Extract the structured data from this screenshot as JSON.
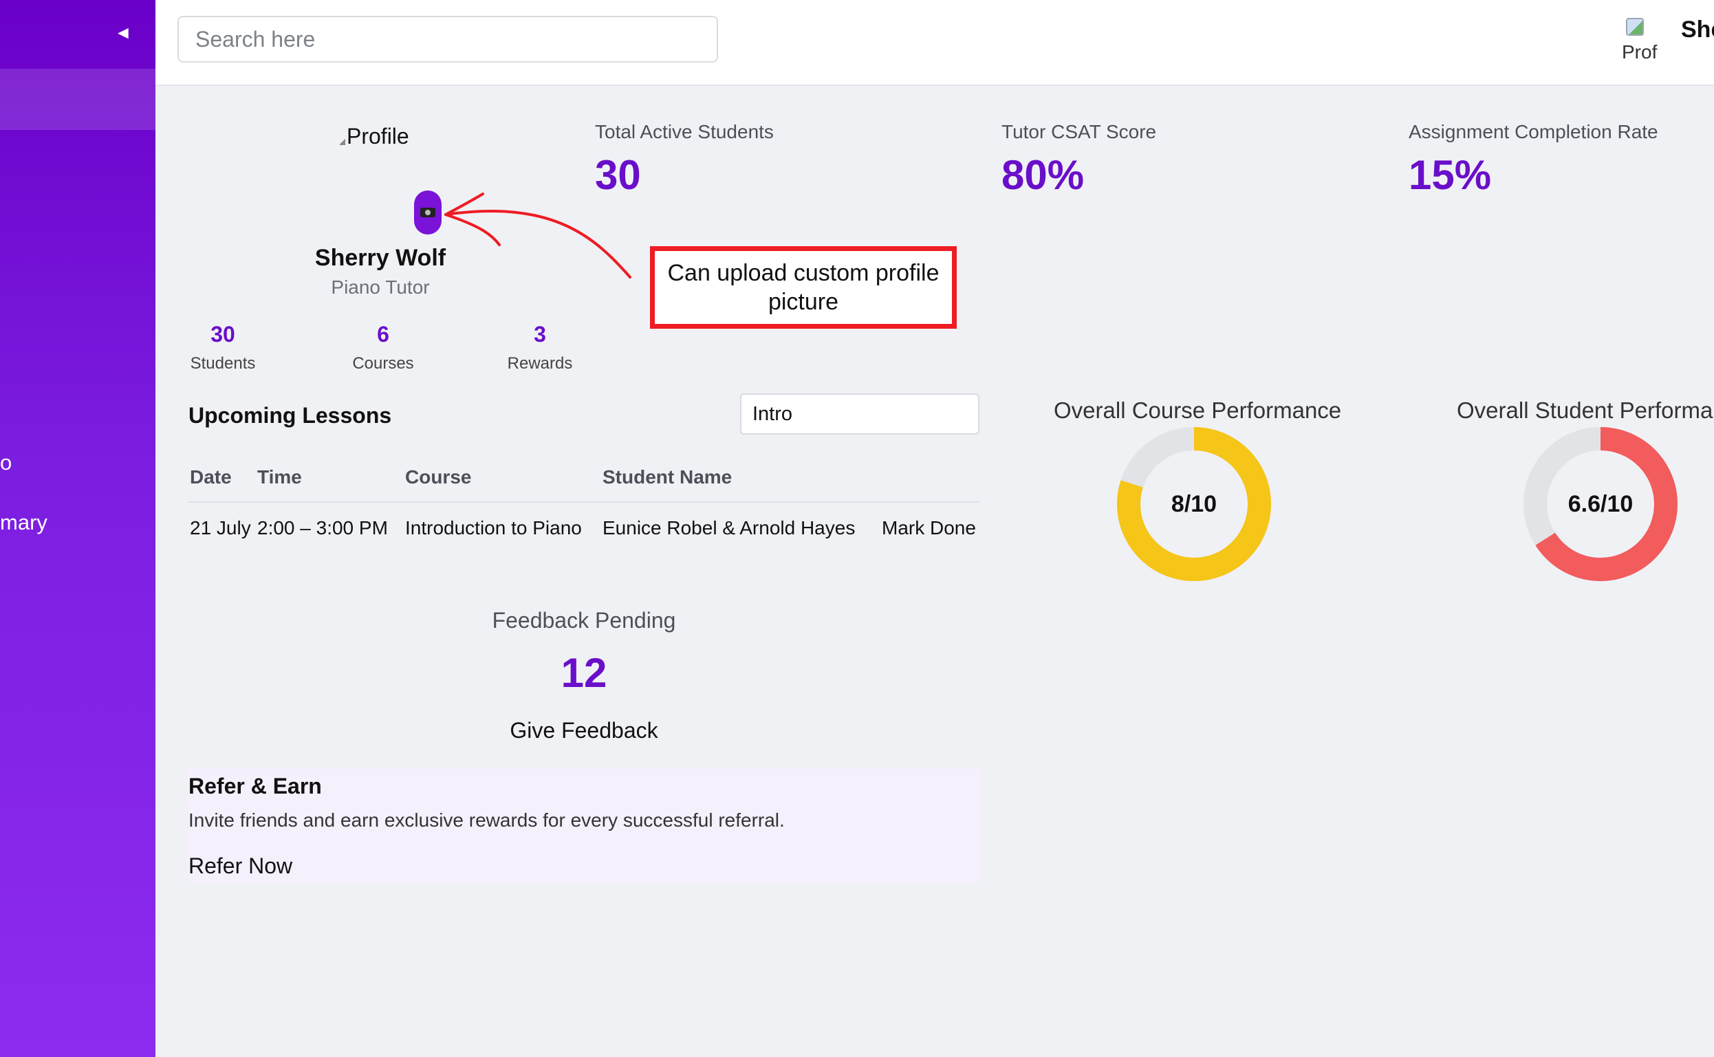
{
  "sidebar": {
    "toggle_icon": "◄",
    "items": [
      {
        "label": "o"
      },
      {
        "label": "mary"
      }
    ]
  },
  "header": {
    "search_placeholder": "Search here",
    "avatar_alt": "Prof",
    "user_name": "She"
  },
  "profile": {
    "image_alt": "Profile",
    "camera_icon": "camera-icon",
    "name": "Sherry Wolf",
    "role": "Piano Tutor",
    "stats": [
      {
        "value": "30",
        "label": "Students"
      },
      {
        "value": "6",
        "label": "Courses"
      },
      {
        "value": "3",
        "label": "Rewards"
      }
    ]
  },
  "kpis": [
    {
      "label": "Total Active Students",
      "value": "30"
    },
    {
      "label": "Tutor CSAT Score",
      "value": "80%"
    },
    {
      "label": "Assignment Completion Rate",
      "value": "15%"
    }
  ],
  "annotation": {
    "text": "Can upload custom profile picture",
    "color": "#ee1c23"
  },
  "lessons": {
    "title": "Upcoming Lessons",
    "filter_value": "Intro",
    "columns": [
      "Date",
      "Time",
      "Course",
      "Student Name"
    ],
    "rows": [
      {
        "date": "21 July",
        "time": "2:00 – 3:00 PM",
        "course": "Introduction to Piano",
        "students": "Eunice Robel & Arnold Hayes",
        "action": "Mark Done"
      }
    ]
  },
  "feedback": {
    "label": "Feedback Pending",
    "value": "12",
    "button": "Give Feedback"
  },
  "refer": {
    "title": "Refer & Earn",
    "description": "Invite friends and earn exclusive rewards for every successful referral.",
    "button": "Refer Now"
  },
  "performance": [
    {
      "title": "Overall Course Performance",
      "display": "8/10",
      "score": 8,
      "max": 10,
      "color": "#f5c518"
    },
    {
      "title": "Overall Student Performar",
      "display": "6.6/10",
      "score": 6.6,
      "max": 10,
      "color": "#f25c5c"
    }
  ],
  "colors": {
    "accent": "#6a0fc9",
    "sidebar": "#7a14dd",
    "track": "#e2e3e6"
  }
}
